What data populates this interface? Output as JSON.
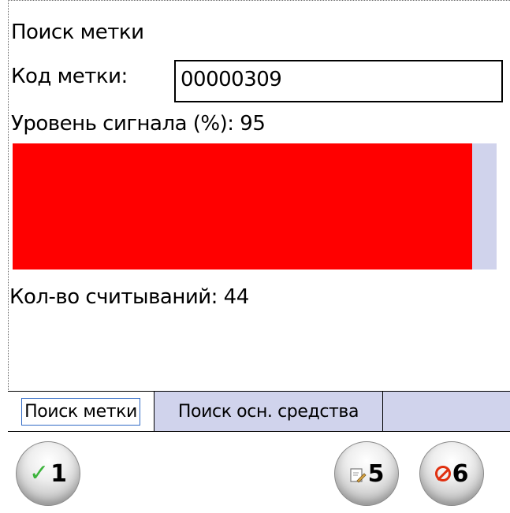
{
  "window": {
    "title": "Поиск метки"
  },
  "form": {
    "code_label": "Код метки:",
    "code_value": "00000309",
    "signal_label": "Уровень сигнала (%): 95",
    "signal_level_percent": 95,
    "signal_fill_color": "#ff0000",
    "signal_track_color": "#d0d3ec",
    "reads_label": "Кол-во считываний: 44"
  },
  "tabs": [
    {
      "label": "Поиск метки",
      "active": true
    },
    {
      "label": "Поиск осн. средства",
      "active": false
    }
  ],
  "toolbar": {
    "buttons": [
      {
        "icon": "check-icon",
        "key": "1"
      },
      {
        "icon": "edit-icon",
        "key": "5"
      },
      {
        "icon": "stop-icon",
        "key": "6"
      }
    ]
  }
}
